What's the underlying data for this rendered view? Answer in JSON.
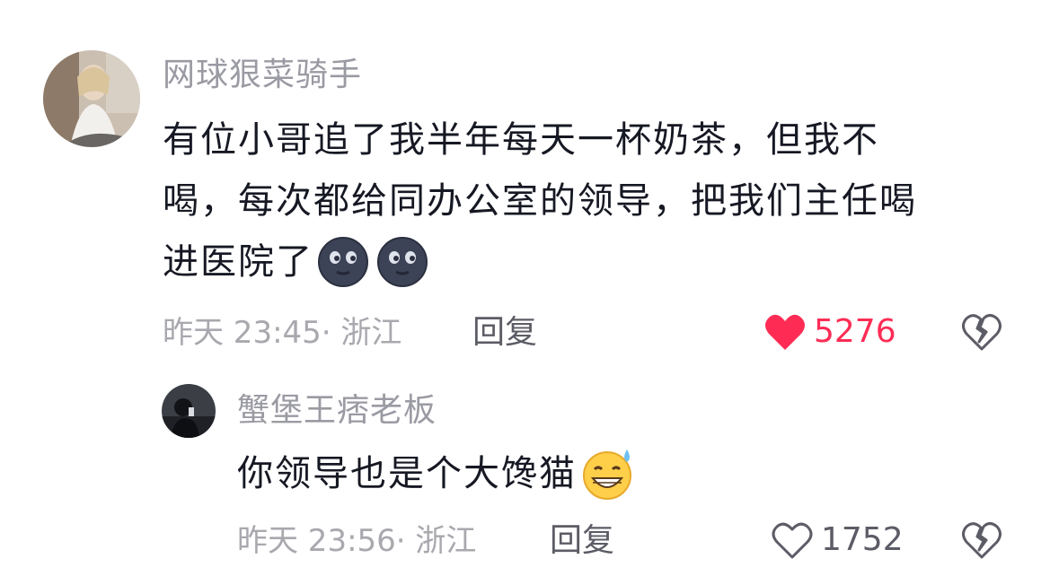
{
  "comment": {
    "username": "网球狠菜骑手",
    "text_lines": [
      "有位小哥追了我半年每天一杯奶茶，但我不",
      "喝，每次都给同办公室的领导，把我们主任喝",
      "进医院了"
    ],
    "emojis": [
      "new-moon-face-icon",
      "new-moon-face-icon"
    ],
    "timestamp": "昨天 23:45",
    "location": "· 浙江",
    "reply_label": "回复",
    "like_count": "5276",
    "liked": true,
    "like_color": "#fe2c55"
  },
  "reply": {
    "username": "蟹堡王痞老板",
    "text": "你领导也是个大馋猫",
    "emoji": "grinning-sweat-face-icon",
    "timestamp": "昨天 23:56",
    "location": "· 浙江",
    "reply_label": "回复",
    "like_count": "1752",
    "liked": false
  }
}
